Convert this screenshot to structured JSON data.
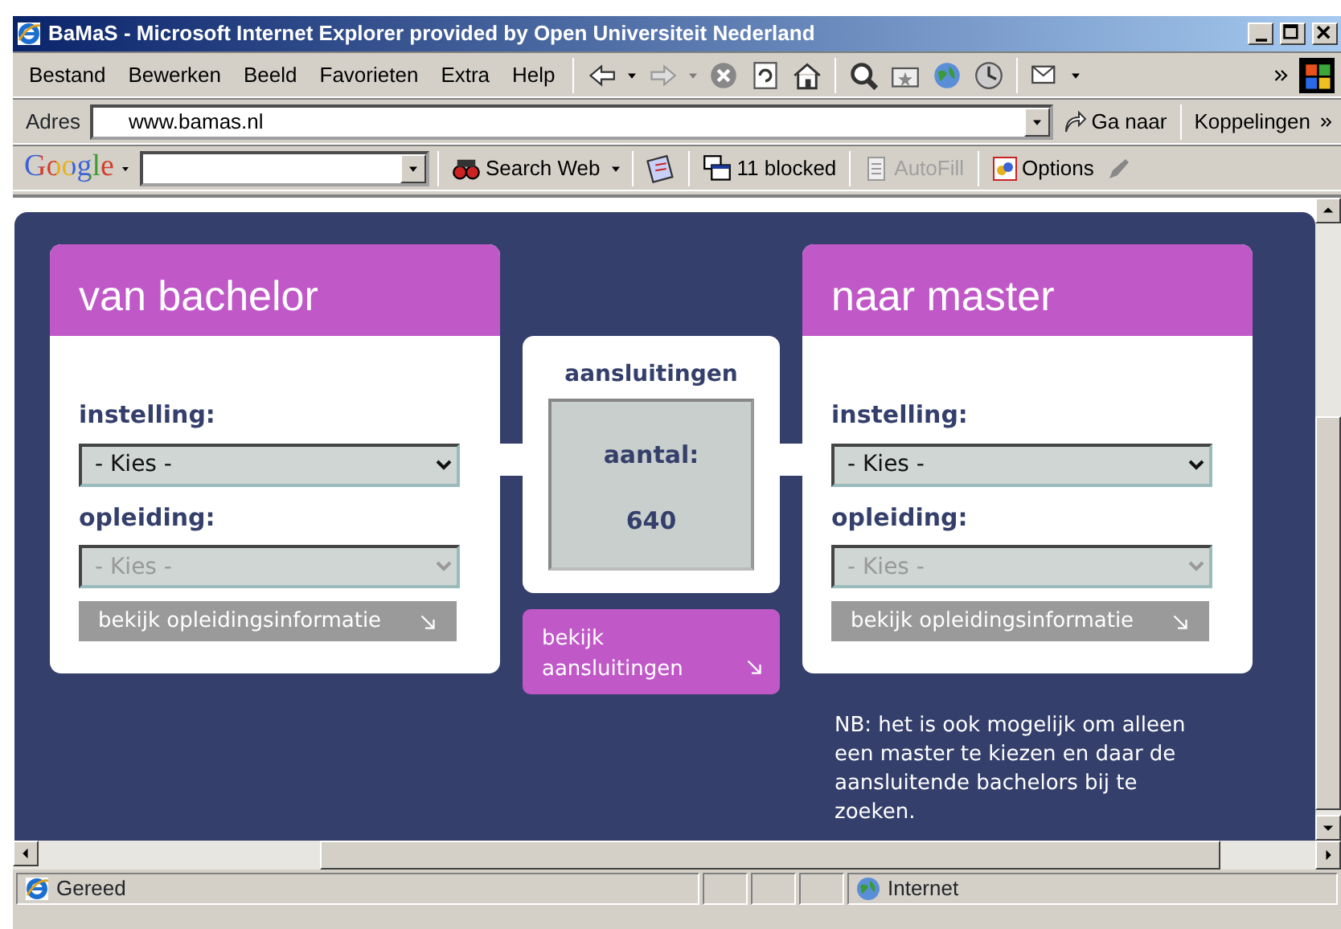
{
  "window": {
    "title": "BaMaS - Microsoft Internet Explorer provided by Open Universiteit Nederland"
  },
  "menu": [
    "Bestand",
    "Bewerken",
    "Beeld",
    "Favorieten",
    "Extra",
    "Help"
  ],
  "address_bar": {
    "label": "Adres",
    "value": "www.bamas.nl",
    "go_button": "Ga naar",
    "links": "Koppelingen"
  },
  "google_toolbar": {
    "logo": "Google",
    "search_button": "Search Web",
    "blocked": "11 blocked",
    "autofill": {
      "label": "AutoFill",
      "disabled": true
    },
    "options": "Options"
  },
  "page": {
    "from_card": {
      "title": "van bachelor",
      "fields": [
        {
          "label": "instelling:",
          "value": "- Kies -",
          "disabled": false
        },
        {
          "label": "opleiding:",
          "value": "- Kies -",
          "disabled": true
        }
      ],
      "button": {
        "label": "bekijk opleidingsinformatie",
        "disabled": true
      }
    },
    "connections": {
      "title": "aansluitingen",
      "count_label": "aantal:",
      "count": "640",
      "button": {
        "label": "bekijk aansluitingen",
        "disabled": false
      }
    },
    "to_card": {
      "title": "naar master",
      "fields": [
        {
          "label": "instelling:",
          "value": "- Kies -",
          "disabled": false
        },
        {
          "label": "opleiding:",
          "value": "- Kies -",
          "disabled": true
        }
      ],
      "button": {
        "label": "bekijk opleidingsinformatie",
        "disabled": true
      }
    },
    "note": "NB: het is ook mogelijk om alleen een master te kiezen en daar de aansluitende bachelors bij te zoeken."
  },
  "status_bar": {
    "status": "Gereed",
    "zone": "Internet"
  }
}
